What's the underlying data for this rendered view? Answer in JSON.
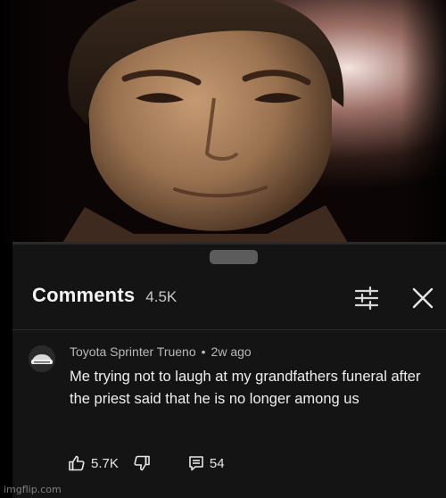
{
  "comments": {
    "title": "Comments",
    "count": "4.5K"
  },
  "comment": {
    "author": "Toyota Sprinter Trueno",
    "separator": "•",
    "time_ago": "2w ago",
    "text": "Me trying not to laugh at my grandfathers funeral after the priest said that he is no longer among us",
    "likes": "5.7K",
    "replies": "54"
  },
  "icons": {
    "filter": "sort-filter-icon",
    "close": "close-icon",
    "like": "thumbs-up-icon",
    "dislike": "thumbs-down-icon",
    "reply": "reply-comment-icon"
  },
  "video": {
    "progress": 0.0
  },
  "watermark": "imgflip.com",
  "colors": {
    "panel_bg": "#141414",
    "accent_red": "#ee0000"
  }
}
